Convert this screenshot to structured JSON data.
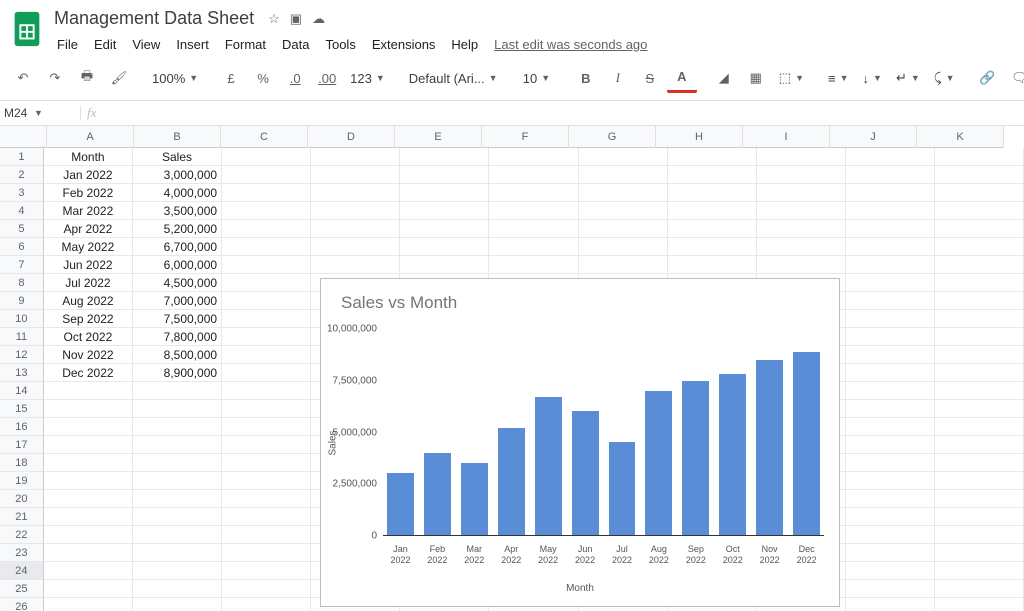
{
  "doc": {
    "title": "Management Data Sheet"
  },
  "menu": {
    "file": "File",
    "edit": "Edit",
    "view": "View",
    "insert": "Insert",
    "format": "Format",
    "data": "Data",
    "tools": "Tools",
    "extensions": "Extensions",
    "help": "Help",
    "lastedit": "Last edit was seconds ago"
  },
  "toolbar": {
    "zoom": "100%",
    "currency": "£",
    "percent": "%",
    "dec_less": ".0",
    "dec_more": ".00",
    "fmt123": "123",
    "font": "Default (Ari...",
    "size": "10"
  },
  "namebox": "M24",
  "fx": "fx",
  "columns": [
    "A",
    "B",
    "C",
    "D",
    "E",
    "F",
    "G",
    "H",
    "I",
    "J",
    "K"
  ],
  "headers": {
    "A": "Month",
    "B": "Sales"
  },
  "table": [
    {
      "month": "Jan 2022",
      "sales": "3,000,000"
    },
    {
      "month": "Feb 2022",
      "sales": "4,000,000"
    },
    {
      "month": "Mar 2022",
      "sales": "3,500,000"
    },
    {
      "month": "Apr 2022",
      "sales": "5,200,000"
    },
    {
      "month": "May 2022",
      "sales": "6,700,000"
    },
    {
      "month": "Jun 2022",
      "sales": "6,000,000"
    },
    {
      "month": "Jul 2022",
      "sales": "4,500,000"
    },
    {
      "month": "Aug 2022",
      "sales": "7,000,000"
    },
    {
      "month": "Sep 2022",
      "sales": "7,500,000"
    },
    {
      "month": "Oct 2022",
      "sales": "7,800,000"
    },
    {
      "month": "Nov 2022",
      "sales": "8,500,000"
    },
    {
      "month": "Dec 2022",
      "sales": "8,900,000"
    }
  ],
  "row_count": 26,
  "selected_row": 24,
  "chart_data": {
    "type": "bar",
    "title": "Sales vs Month",
    "xlabel": "Month",
    "ylabel": "Sales",
    "ylim": [
      0,
      10000000
    ],
    "yticks": [
      {
        "v": 0,
        "label": "0"
      },
      {
        "v": 2500000,
        "label": "2,500,000"
      },
      {
        "v": 5000000,
        "label": "5,000,000"
      },
      {
        "v": 7500000,
        "label": "7,500,000"
      },
      {
        "v": 10000000,
        "label": "10,000,000"
      }
    ],
    "categories": [
      "Jan 2022",
      "Feb 2022",
      "Mar 2022",
      "Apr 2022",
      "May 2022",
      "Jun 2022",
      "Jul 2022",
      "Aug 2022",
      "Sep 2022",
      "Oct 2022",
      "Nov 2022",
      "Dec 2022"
    ],
    "values": [
      3000000,
      4000000,
      3500000,
      5200000,
      6700000,
      6000000,
      4500000,
      7000000,
      7500000,
      7800000,
      8500000,
      8900000
    ]
  }
}
